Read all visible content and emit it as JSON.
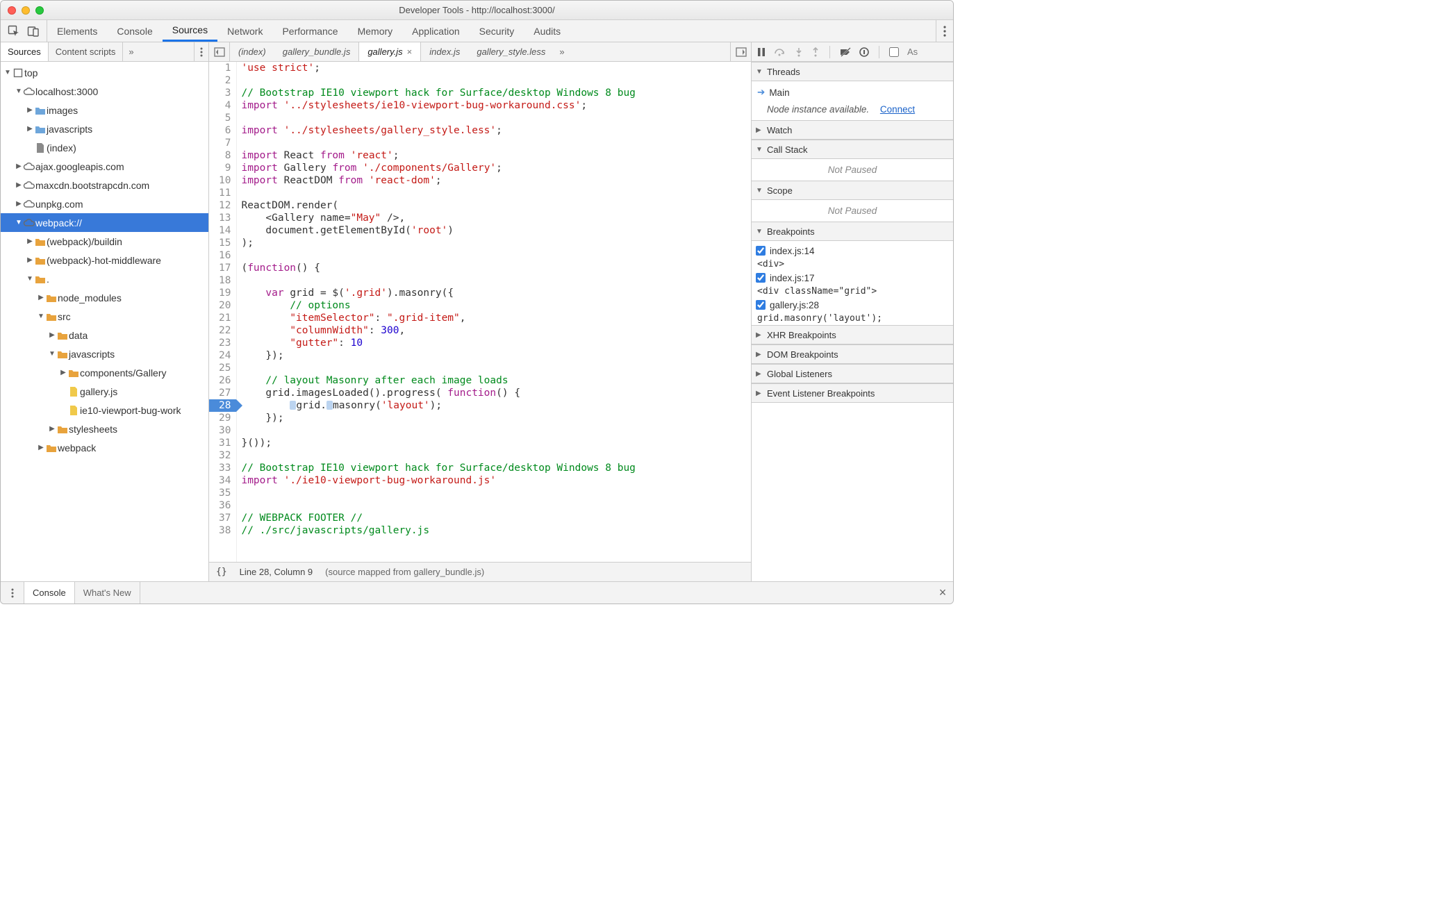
{
  "window_title": "Developer Tools - http://localhost:3000/",
  "panel_tabs": [
    "Elements",
    "Console",
    "Sources",
    "Network",
    "Performance",
    "Memory",
    "Application",
    "Security",
    "Audits"
  ],
  "panel_active": "Sources",
  "left_tabs": {
    "active": "Sources",
    "other": "Content scripts"
  },
  "navigator": {
    "root": "top",
    "domains": [
      {
        "name": "localhost:3000",
        "expanded": true,
        "children": [
          {
            "name": "images",
            "type": "folder"
          },
          {
            "name": "javascripts",
            "type": "folder"
          },
          {
            "name": "(index)",
            "type": "file"
          }
        ]
      },
      {
        "name": "ajax.googleapis.com",
        "expanded": false
      },
      {
        "name": "maxcdn.bootstrapcdn.com",
        "expanded": false
      },
      {
        "name": "unpkg.com",
        "expanded": false
      },
      {
        "name": "webpack://",
        "expanded": true,
        "selected": true,
        "children": [
          {
            "name": "(webpack)/buildin",
            "type": "wfolder"
          },
          {
            "name": "(webpack)-hot-middleware",
            "type": "wfolder"
          },
          {
            "name": ".",
            "type": "wfolder",
            "expanded": true,
            "children": [
              {
                "name": "node_modules",
                "type": "wfolder"
              },
              {
                "name": "src",
                "type": "wfolder",
                "expanded": true,
                "children": [
                  {
                    "name": "data",
                    "type": "wfolder"
                  },
                  {
                    "name": "javascripts",
                    "type": "wfolder",
                    "expanded": true,
                    "children": [
                      {
                        "name": "components/Gallery",
                        "type": "wfolder"
                      },
                      {
                        "name": "gallery.js",
                        "type": "wfile"
                      },
                      {
                        "name": "ie10-viewport-bug-work",
                        "type": "wfile"
                      }
                    ]
                  },
                  {
                    "name": "stylesheets",
                    "type": "wfolder"
                  }
                ]
              },
              {
                "name": "webpack",
                "type": "wfolder"
              }
            ]
          }
        ]
      }
    ]
  },
  "file_tabs": [
    "(index)",
    "gallery_bundle.js",
    "gallery.js",
    "index.js",
    "gallery_style.less"
  ],
  "file_tab_active": "gallery.js",
  "code_lines": [
    [
      {
        "t": "'use strict'",
        "c": "tk-str"
      },
      {
        "t": ";"
      }
    ],
    [],
    [
      {
        "t": "// Bootstrap IE10 viewport hack for Surface/desktop Windows 8 bug",
        "c": "tk-com"
      }
    ],
    [
      {
        "t": "import",
        "c": "tk-kw"
      },
      {
        "t": " "
      },
      {
        "t": "'../stylesheets/ie10-viewport-bug-workaround.css'",
        "c": "tk-str"
      },
      {
        "t": ";"
      }
    ],
    [],
    [
      {
        "t": "import",
        "c": "tk-kw"
      },
      {
        "t": " "
      },
      {
        "t": "'../stylesheets/gallery_style.less'",
        "c": "tk-str"
      },
      {
        "t": ";"
      }
    ],
    [],
    [
      {
        "t": "import",
        "c": "tk-kw"
      },
      {
        "t": " React "
      },
      {
        "t": "from",
        "c": "tk-kw"
      },
      {
        "t": " "
      },
      {
        "t": "'react'",
        "c": "tk-str"
      },
      {
        "t": ";"
      }
    ],
    [
      {
        "t": "import",
        "c": "tk-kw"
      },
      {
        "t": " Gallery "
      },
      {
        "t": "from",
        "c": "tk-kw"
      },
      {
        "t": " "
      },
      {
        "t": "'./components/Gallery'",
        "c": "tk-str"
      },
      {
        "t": ";"
      }
    ],
    [
      {
        "t": "import",
        "c": "tk-kw"
      },
      {
        "t": " ReactDOM "
      },
      {
        "t": "from",
        "c": "tk-kw"
      },
      {
        "t": " "
      },
      {
        "t": "'react-dom'",
        "c": "tk-str"
      },
      {
        "t": ";"
      }
    ],
    [],
    [
      {
        "t": "ReactDOM.render("
      }
    ],
    [
      {
        "t": "    <Gallery name="
      },
      {
        "t": "\"May\"",
        "c": "tk-str"
      },
      {
        "t": " />,"
      }
    ],
    [
      {
        "t": "    document.getElementById("
      },
      {
        "t": "'root'",
        "c": "tk-str"
      },
      {
        "t": ")"
      }
    ],
    [
      {
        "t": ");"
      }
    ],
    [],
    [
      {
        "t": "("
      },
      {
        "t": "function",
        "c": "tk-kw"
      },
      {
        "t": "() {"
      }
    ],
    [],
    [
      {
        "t": "    "
      },
      {
        "t": "var",
        "c": "tk-kw"
      },
      {
        "t": " grid = $("
      },
      {
        "t": "'.grid'",
        "c": "tk-str"
      },
      {
        "t": ").masonry({"
      }
    ],
    [
      {
        "t": "        "
      },
      {
        "t": "// options",
        "c": "tk-com"
      }
    ],
    [
      {
        "t": "        "
      },
      {
        "t": "\"itemSelector\"",
        "c": "tk-str"
      },
      {
        "t": ": "
      },
      {
        "t": "\".grid-item\"",
        "c": "tk-str"
      },
      {
        "t": ","
      }
    ],
    [
      {
        "t": "        "
      },
      {
        "t": "\"columnWidth\"",
        "c": "tk-str"
      },
      {
        "t": ": "
      },
      {
        "t": "300",
        "c": "tk-num"
      },
      {
        "t": ","
      }
    ],
    [
      {
        "t": "        "
      },
      {
        "t": "\"gutter\"",
        "c": "tk-str"
      },
      {
        "t": ": "
      },
      {
        "t": "10",
        "c": "tk-num"
      }
    ],
    [
      {
        "t": "    });"
      }
    ],
    [],
    [
      {
        "t": "    "
      },
      {
        "t": "// layout Masonry after each image loads",
        "c": "tk-com"
      }
    ],
    [
      {
        "t": "    grid.imagesLoaded().progress( "
      },
      {
        "t": "function",
        "c": "tk-kw"
      },
      {
        "t": "() {"
      }
    ],
    [
      {
        "t": "        "
      },
      {
        "m": true
      },
      {
        "t": "grid."
      },
      {
        "m": true
      },
      {
        "t": "masonry("
      },
      {
        "t": "'layout'",
        "c": "tk-str"
      },
      {
        "t": ");"
      }
    ],
    [
      {
        "t": "    });"
      }
    ],
    [],
    [
      {
        "t": "}());"
      }
    ],
    [],
    [
      {
        "t": "// Bootstrap IE10 viewport hack for Surface/desktop Windows 8 bug",
        "c": "tk-com"
      }
    ],
    [
      {
        "t": "import",
        "c": "tk-kw"
      },
      {
        "t": " "
      },
      {
        "t": "'./ie10-viewport-bug-workaround.js'",
        "c": "tk-str"
      }
    ],
    [],
    [],
    [
      {
        "t": "// WEBPACK FOOTER //",
        "c": "tk-com"
      }
    ],
    [
      {
        "t": "// ./src/javascripts/gallery.js",
        "c": "tk-com"
      }
    ]
  ],
  "breakpoint_line": 28,
  "status_bar": {
    "braces": "{}",
    "pos": "Line 28, Column 9",
    "mapped": "(source mapped from gallery_bundle.js)"
  },
  "debugger": {
    "sections": {
      "threads": {
        "label": "Threads",
        "main": "Main",
        "node_msg": "Node instance available.",
        "connect": "Connect"
      },
      "watch": "Watch",
      "callstack": {
        "label": "Call Stack",
        "body": "Not Paused"
      },
      "scope": {
        "label": "Scope",
        "body": "Not Paused"
      },
      "breakpoints": {
        "label": "Breakpoints",
        "items": [
          {
            "label": "index.js:14",
            "sub": "<div>"
          },
          {
            "label": "index.js:17",
            "sub": "<div className=\"grid\">"
          },
          {
            "label": "gallery.js:28",
            "sub": "grid.masonry('layout');"
          }
        ]
      },
      "xhr": "XHR Breakpoints",
      "dom": "DOM Breakpoints",
      "global": "Global Listeners",
      "event": "Event Listener Breakpoints"
    },
    "async_label": "As"
  },
  "drawer": {
    "tabs": [
      "Console",
      "What's New"
    ]
  }
}
